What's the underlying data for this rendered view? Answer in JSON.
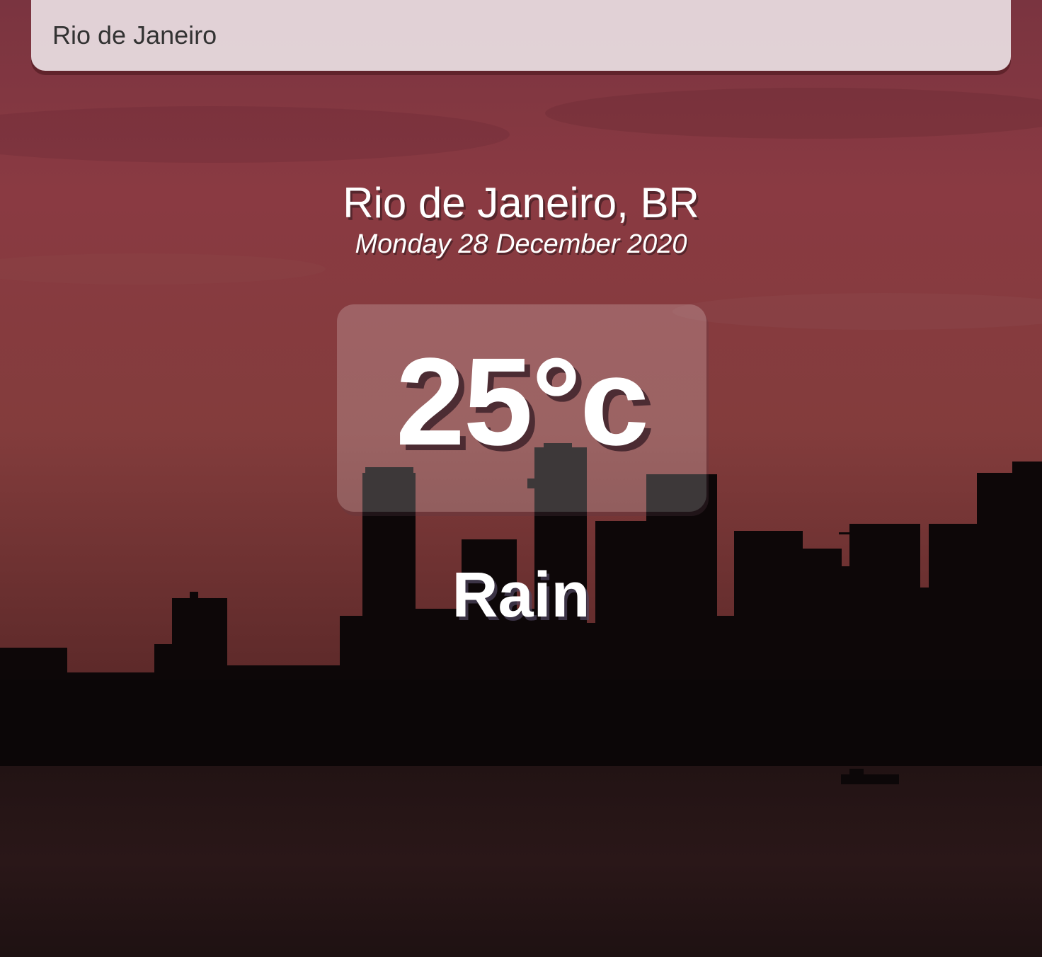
{
  "search": {
    "value": "Rio de Janeiro"
  },
  "location": {
    "city": "Rio de Janeiro, BR",
    "date": "Monday 28 December 2020"
  },
  "weather": {
    "temperature": "25°c",
    "condition": "Rain"
  },
  "colors": {
    "sky_top": "#8a3a3e",
    "sky_bottom": "#6d2c2c",
    "skyline": "#0d0708",
    "water": "#1e1112"
  }
}
